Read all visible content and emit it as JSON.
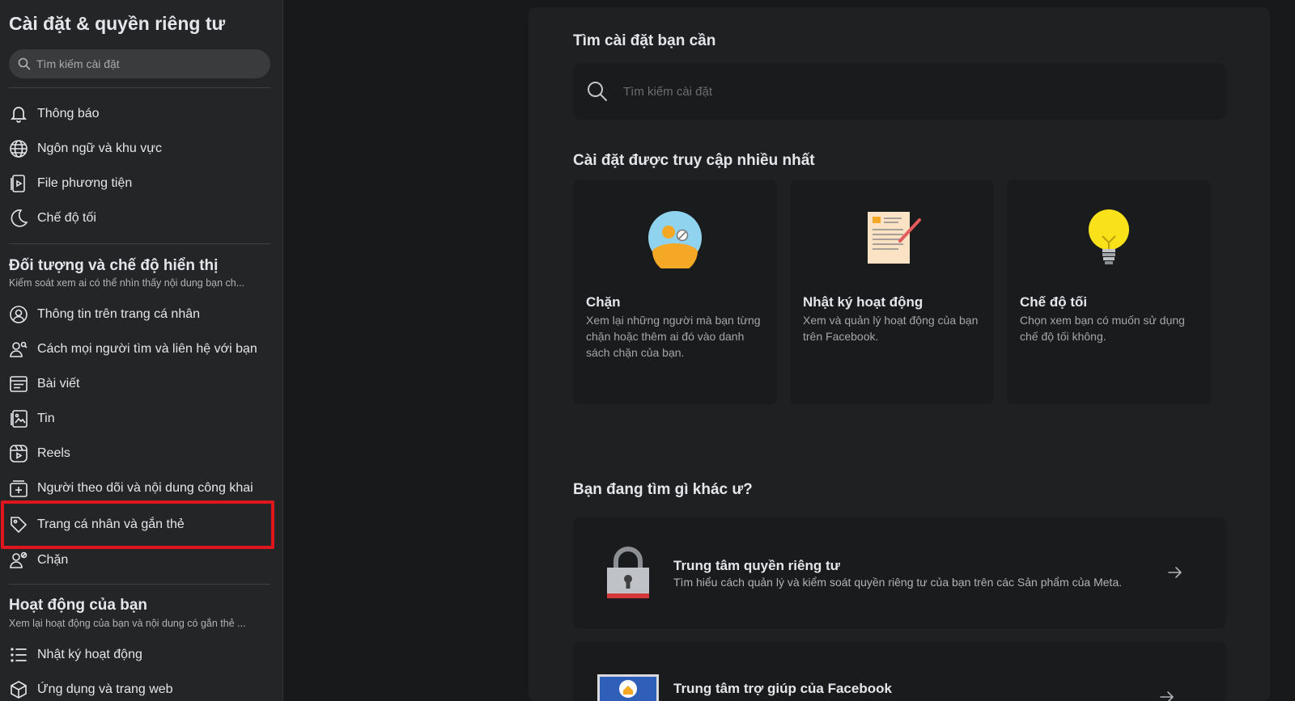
{
  "sidebar": {
    "title": "Cài đặt & quyền riêng tư",
    "search_placeholder": "Tìm kiếm cài đặt",
    "group1": [
      {
        "label": "Thông báo",
        "icon": "bell-icon"
      },
      {
        "label": "Ngôn ngữ và khu vực",
        "icon": "globe-icon"
      },
      {
        "label": "File phương tiện",
        "icon": "media-file-icon"
      },
      {
        "label": "Chế độ tối",
        "icon": "moon-icon"
      }
    ],
    "section_audience": {
      "title": "Đối tượng và chế độ hiển thị",
      "subtitle": "Kiểm soát xem ai có thể nhìn thấy nội dung bạn ch...",
      "items": [
        {
          "label": "Thông tin trên trang cá nhân",
          "icon": "profile-circle-icon"
        },
        {
          "label": "Cách mọi người tìm và liên hệ với bạn",
          "icon": "find-contact-icon"
        },
        {
          "label": "Bài viết",
          "icon": "posts-icon"
        },
        {
          "label": "Tin",
          "icon": "stories-icon"
        },
        {
          "label": "Reels",
          "icon": "reels-icon"
        },
        {
          "label": "Người theo dõi và nội dung công khai",
          "icon": "followers-icon"
        },
        {
          "label": "Trang cá nhân và gắn thẻ",
          "icon": "tag-icon"
        },
        {
          "label": "Chặn",
          "icon": "block-user-icon"
        }
      ]
    },
    "section_activity": {
      "title": "Hoạt động của bạn",
      "subtitle": "Xem lại hoạt động của bạn và nội dung có gắn thẻ ...",
      "items": [
        {
          "label": "Nhật ký hoạt động",
          "icon": "list-icon"
        },
        {
          "label": "Ứng dụng và trang web",
          "icon": "cube-icon"
        }
      ]
    }
  },
  "main": {
    "search_heading": "Tìm cài đặt bạn cần",
    "search_placeholder": "Tìm kiếm cài đặt",
    "most_visited_heading": "Cài đặt được truy cập nhiều nhất",
    "cards": [
      {
        "title": "Chặn",
        "desc": "Xem lại những người mà bạn từng chặn hoặc thêm ai đó vào danh sách chặn của bạn.",
        "icon": "blocked-person-icon"
      },
      {
        "title": "Nhật ký hoạt động",
        "desc": "Xem và quản lý hoạt động của bạn trên Facebook.",
        "icon": "activity-document-icon"
      },
      {
        "title": "Chế độ tối",
        "desc": "Chọn xem bạn có muốn sử dụng chế độ tối không.",
        "icon": "lightbulb-icon"
      }
    ],
    "other_heading": "Bạn đang tìm gì khác ư?",
    "links": [
      {
        "title": "Trung tâm quyền riêng tư",
        "desc": "Tìm hiểu cách quản lý và kiểm soát quyền riêng tư của bạn trên các Sản phẩm của Meta.",
        "icon": "padlock-icon"
      },
      {
        "title": "Trung tâm trợ giúp của Facebook",
        "desc": "",
        "icon": "help-center-icon"
      }
    ]
  },
  "colors": {
    "highlight": "#e0161f",
    "background": "#18191a",
    "sidebar": "#242526"
  }
}
